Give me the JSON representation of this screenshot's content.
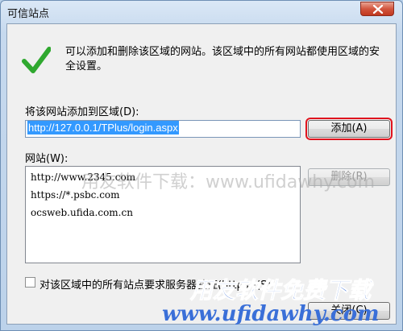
{
  "dialog": {
    "title": "可信站点",
    "description": "可以添加和删除该区域的网站。该区域中的所有网站都使用区域的安全设置。"
  },
  "add_section": {
    "label": "将该网站添加到区域(D):",
    "url_value": "http://127.0.0.1/TPlus/login.aspx",
    "add_button": "添加(A)"
  },
  "sites_section": {
    "label": "网站(W):",
    "sites": [
      "http://www.2345.com",
      "https://*.psbc.com",
      "ocsweb.ufida.com.cn"
    ],
    "remove_button": "删除(R)"
  },
  "https_option": {
    "label": "对该区域中的所有站点要求服务器验证(https:)(S)",
    "checked": false
  },
  "close_button": "关闭(C)",
  "watermarks": {
    "line1": "用友软件下载：www.ufidawhy.com",
    "logo_cn": "用友软件免费下载",
    "logo_url": "www.ufidawhy.com"
  },
  "colors": {
    "accent": "#e0141e",
    "selection": "#3399ff",
    "check": "#2fa82f",
    "watermark_blue": "#3a6fd8"
  }
}
